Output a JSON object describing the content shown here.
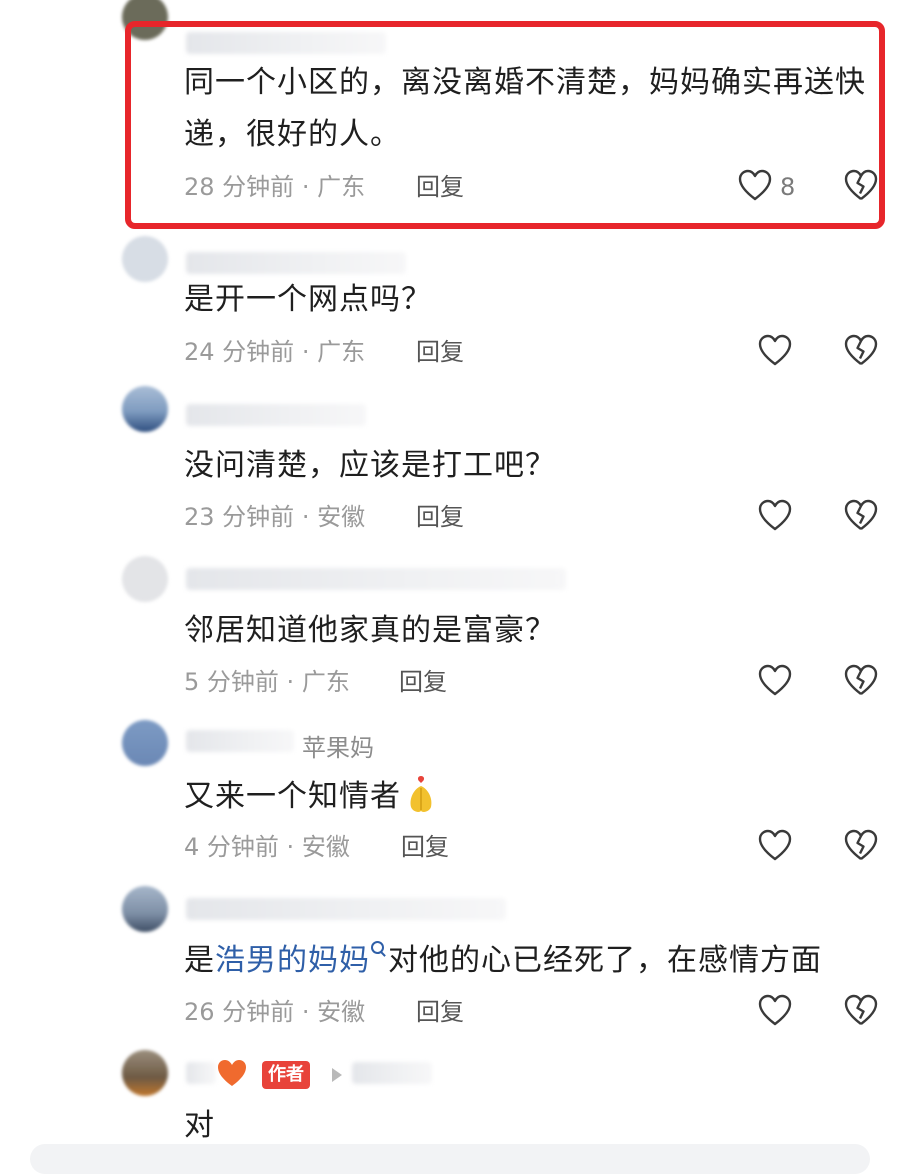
{
  "colors": {
    "highlight_border": "#e7262b",
    "link": "#2f5fa8",
    "meta": "#9a9a9a",
    "author_badge": "#e8433a"
  },
  "comments": [
    {
      "text": "同一个小区的，离没离婚不清楚，妈妈确实再送快递，很好的人。",
      "time": "28 分钟前",
      "location": "广东",
      "reply_label": "回复",
      "likes": "8",
      "highlighted": true
    },
    {
      "text": "是开一个网点吗？",
      "time": "24 分钟前",
      "location": "广东",
      "reply_label": "回复"
    },
    {
      "text": "没问清楚，应该是打工吧？",
      "time": "23 分钟前",
      "location": "安徽",
      "reply_label": "回复"
    },
    {
      "text": "邻居知道他家真的是富豪？",
      "time": "5 分钟前",
      "location": "广东",
      "reply_label": "回复"
    },
    {
      "username": "苹果妈",
      "text": "又来一个知情者",
      "time": "4 分钟前",
      "location": "安徽",
      "reply_label": "回复"
    },
    {
      "text_prefix": "是",
      "text_link": "浩男的妈妈",
      "text_suffix": "对他的心已经死了，在感情方面",
      "time": "26 分钟前",
      "location": "安徽",
      "reply_label": "回复"
    },
    {
      "author_badge": "作者",
      "text": "对"
    }
  ],
  "separator": "·",
  "icons": {
    "like": "heart-outline-icon",
    "dislike": "broken-heart-icon",
    "emoji": "pray-hands-emoji-icon",
    "link_search": "search-icon",
    "author_heart": "heart-emoji-icon"
  }
}
